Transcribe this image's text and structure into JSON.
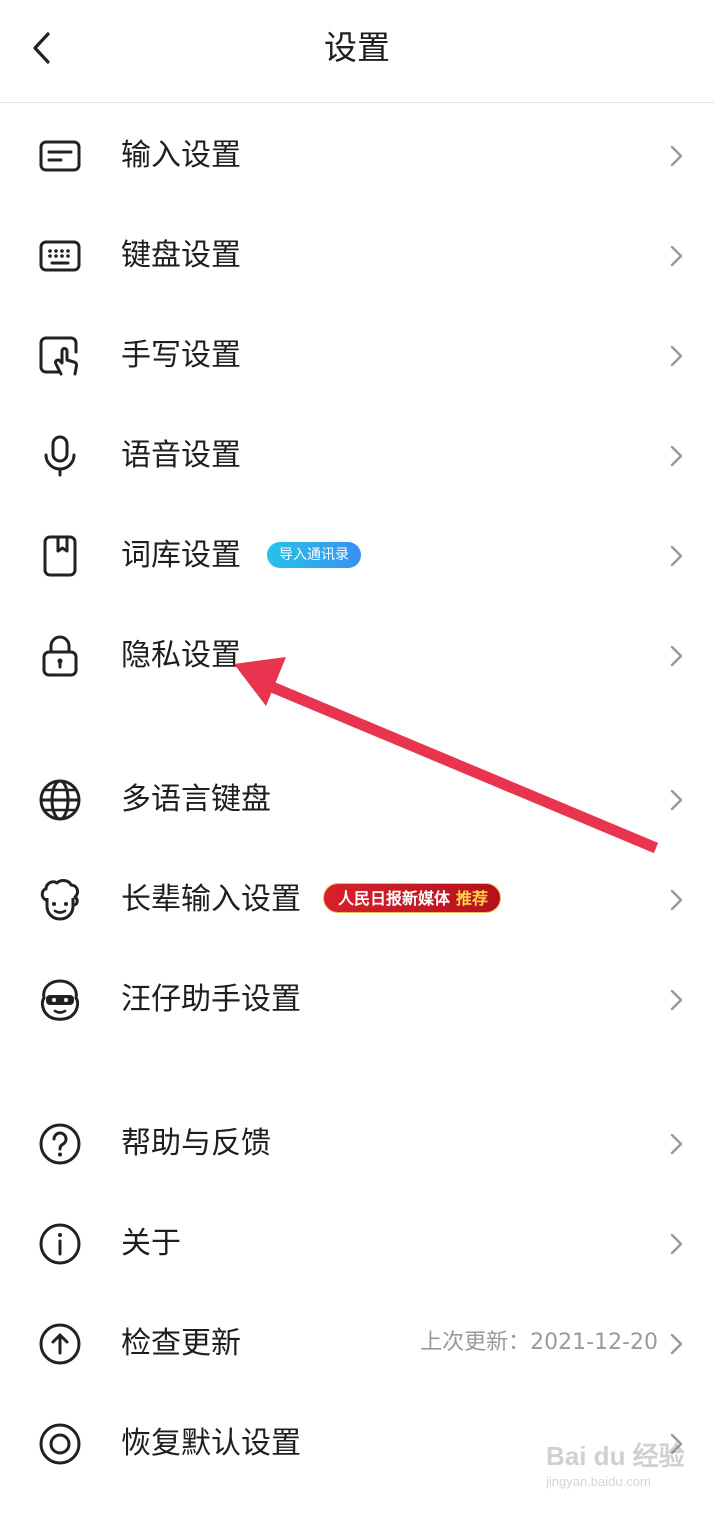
{
  "header": {
    "title": "设置",
    "back_icon": "chevron-left-icon"
  },
  "groups": [
    {
      "items": [
        {
          "label": "输入设置",
          "icon": "input-box-icon"
        },
        {
          "label": "键盘设置",
          "icon": "keyboard-icon"
        },
        {
          "label": "手写设置",
          "icon": "handwrite-icon"
        },
        {
          "label": "语音设置",
          "icon": "microphone-icon"
        },
        {
          "label": "词库设置",
          "icon": "bookmark-book-icon",
          "badge": "导入通讯录"
        },
        {
          "label": "隐私设置",
          "icon": "lock-icon"
        }
      ]
    },
    {
      "items": [
        {
          "label": "多语言键盘",
          "icon": "globe-icon"
        },
        {
          "label": "长辈输入设置",
          "icon": "elder-face-icon",
          "badge_main": "人民日报新媒体",
          "badge_highlight": "推荐"
        },
        {
          "label": "汪仔助手设置",
          "icon": "mascot-face-icon"
        }
      ]
    },
    {
      "items": [
        {
          "label": "帮助与反馈",
          "icon": "question-icon"
        },
        {
          "label": "关于",
          "icon": "info-icon"
        },
        {
          "label": "检查更新",
          "icon": "upload-circle-icon",
          "subtext": "上次更新：2021-12-20"
        },
        {
          "label": "恢复默认设置",
          "icon": "reset-ring-icon"
        }
      ]
    }
  ],
  "watermark": {
    "main": "Bai du 经验",
    "sub": "jingyan.baidu.com"
  },
  "colors": {
    "annotation_arrow": "#e8344e",
    "badge_blue": "#2fb3ec",
    "badge_red": "#cf1b25"
  }
}
